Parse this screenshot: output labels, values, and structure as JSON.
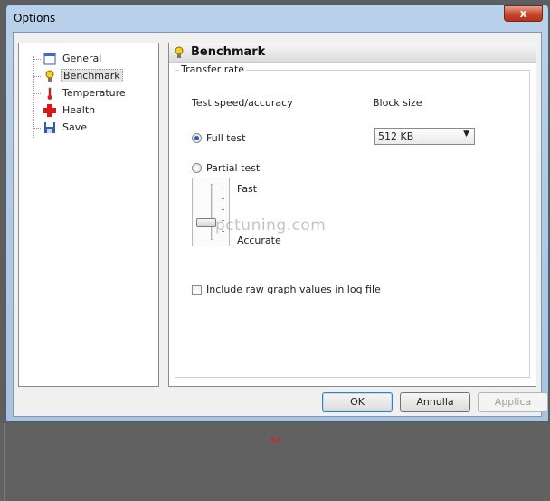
{
  "window": {
    "title": "Options",
    "close_label": "x"
  },
  "tree": {
    "items": [
      {
        "label": "General",
        "icon": "window-icon"
      },
      {
        "label": "Benchmark",
        "icon": "bulb-icon",
        "selected": true
      },
      {
        "label": "Temperature",
        "icon": "thermometer-icon"
      },
      {
        "label": "Health",
        "icon": "health-cross-icon"
      },
      {
        "label": "Save",
        "icon": "floppy-disk-icon"
      }
    ]
  },
  "panel": {
    "title": "Benchmark",
    "group_label": "Transfer rate",
    "speed_label": "Test speed/accuracy",
    "block_label": "Block size",
    "full_test": "Full test",
    "partial_test": "Partial test",
    "fast": "Fast",
    "accurate": "Accurate",
    "block_size": "512 KB",
    "raw_graph": "Include raw graph values in log file",
    "watermark": "pctuning.com"
  },
  "buttons": {
    "ok": "OK",
    "cancel": "Annulla",
    "apply": "Applica"
  },
  "colors": {
    "accent": "#2a5fb0",
    "close": "#c8442a",
    "arrow": "#e02020"
  },
  "resize_icon": "↔"
}
